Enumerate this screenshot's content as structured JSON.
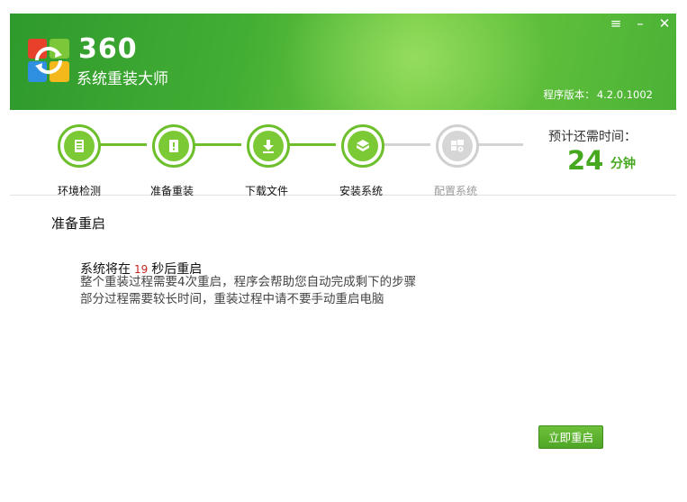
{
  "header": {
    "logo_number": "360",
    "logo_name": "系统重装大师",
    "version_label": "程序版本：",
    "version_value": "4.2.0.1002"
  },
  "window_controls": {
    "menu": "≡",
    "minimize": "–",
    "close": "✕"
  },
  "steps": [
    {
      "label": "环境检测",
      "state": "done",
      "icon": "monitor-icon"
    },
    {
      "label": "准备重装",
      "state": "current",
      "icon": "document-icon"
    },
    {
      "label": "下载文件",
      "state": "done",
      "icon": "download-icon"
    },
    {
      "label": "安装系统",
      "state": "done",
      "icon": "install-icon"
    },
    {
      "label": "配置系统",
      "state": "pending",
      "icon": "windows-config-icon"
    }
  ],
  "eta": {
    "label": "预计还需时间：",
    "value": "24",
    "unit": "分钟"
  },
  "content": {
    "title": "准备重启",
    "countdown_prefix": "系统将在",
    "countdown_value": "19",
    "countdown_suffix": "秒后重启",
    "lines": [
      "整个重装过程需要4次重启，程序会帮助您自动完成剩下的步骤",
      "部分过程需要较长时间，重装过程中请不要手动重启电脑"
    ]
  },
  "buttons": {
    "restart_now": "立即重启"
  },
  "colors": {
    "brand_green": "#46a81f",
    "header_green": "#43ae34",
    "countdown_red": "#c8231e",
    "inactive_gray": "#d3d3d3"
  }
}
